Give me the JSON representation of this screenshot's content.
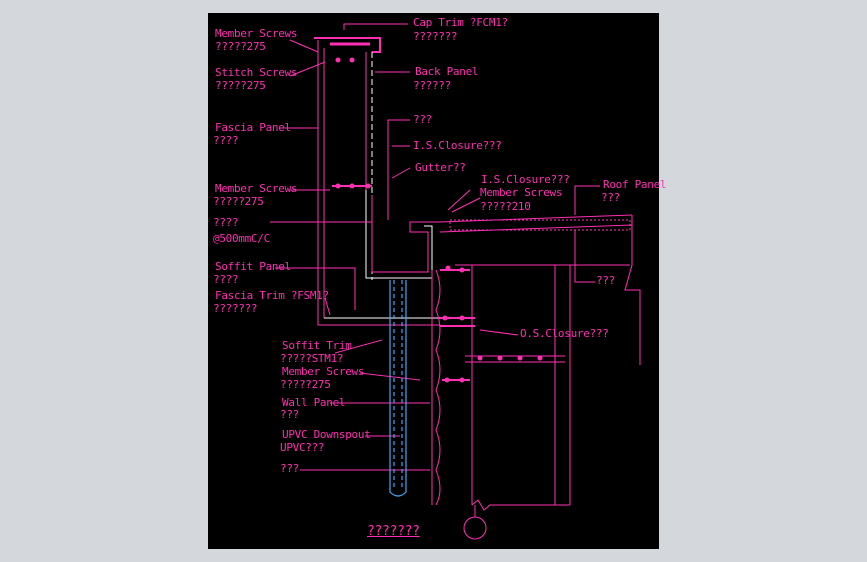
{
  "drawing": {
    "background_color": "#000000",
    "frame_color": "#D4D8DD",
    "line_color": "#FF2FB4",
    "pipe_color": "#3FA9F5",
    "title": "???????"
  },
  "labels": {
    "cap_trim": "Cap Trim ?FCM1?",
    "cap_trim_sub": "???????",
    "member_screws_1": "Member Screws",
    "member_screws_1_sub": "?????275",
    "stitch_screws": "Stitch Screws",
    "stitch_screws_sub": "?????275",
    "back_panel": "Back Panel",
    "back_panel_sub": "??????",
    "fascia_panel": "Fascia Panel",
    "fascia_panel_sub": "????",
    "q3_a": "???",
    "is_closure_1": "I.S.Closure???",
    "gutter": "Gutter??",
    "is_closure_2": "I.S.Closure???",
    "member_screws_2": "Member Screws",
    "member_screws_2_sub": "?????210",
    "roof_panel": "Roof Panel",
    "roof_panel_sub": "???",
    "member_screws_3": "Member Screws",
    "member_screws_3_sub": "?????275",
    "spacing": "????",
    "spacing_sub": "@500mmC/C",
    "soffit_panel": "Soffit Panel",
    "soffit_panel_sub": "????",
    "q3_b": "???",
    "fascia_trim": "Fascia Trim ?FSM1?",
    "fascia_trim_sub": "???????",
    "os_closure": "O.S.Closure???",
    "soffit_trim": "Soffit Trim",
    "soffit_trim_sub": "?????STM1?",
    "member_screws_4": "Member Screws",
    "member_screws_4_sub": "?????275",
    "wall_panel": "Wall Panel",
    "wall_panel_sub": "???",
    "downspout": "UPVC Downspout",
    "downspout_sub": "UPVC???",
    "q3_c": "???"
  }
}
